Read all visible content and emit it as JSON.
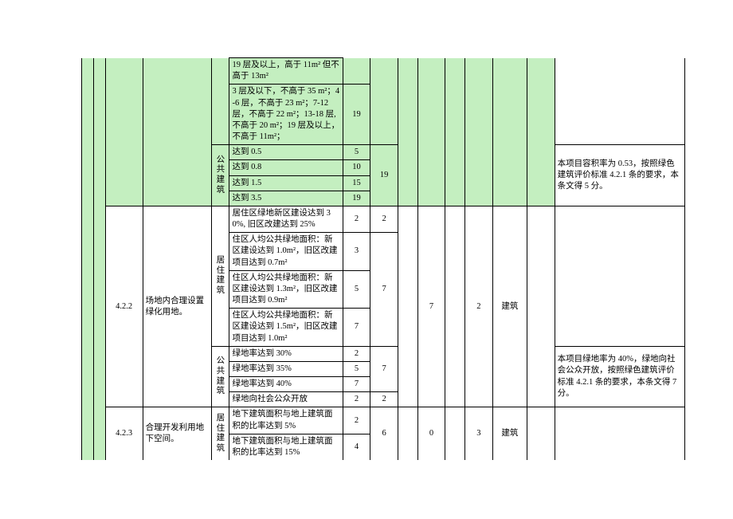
{
  "row421": {
    "type_label": "公共建筑",
    "r1_text": "19 层及以上，高于 11m² 但不高于 13m²",
    "r2_text": "3 层及以下，不高于 35 m²；4-6 层，不高于 23 m²；7-12 层，不高于 22 m²；13-18 层, 不高于 20 m²；19 层及以上，不高于 11m²；",
    "r2_score": "19",
    "level05": "达到 0.5",
    "score05": "5",
    "level08": "达到 0.8",
    "score08": "10",
    "level15": "达到 1.5",
    "score15": "15",
    "level35": "达到 3.5",
    "score35": "19",
    "subtotal": "19",
    "note": "本项目容积率为 0.53，按照绿色建筑评价标准 4.2.1 条的要求，本条文得 5 分。"
  },
  "row422": {
    "id": "4.2.2",
    "title": "场地内合理设置绿化用地。",
    "type1": "居住建筑",
    "type2": "公共建筑",
    "r1_text": "居住区绿地新区建设达到 30%, 旧区改建达到 25%",
    "r1_score": "2",
    "r1_sub": "2",
    "r2_text": "住区人均公共绿地面积：新区建设达到 1.0m²，旧区改建项目达到 0.7m²",
    "r2_score": "3",
    "r3_text": "住区人均公共绿地面积：新区建设达到 1.3m²，旧区改建项目达到 0.9m²",
    "r3_score": "5",
    "r4_text": "住区人均公共绿地面积：新区建设达到 1.5m²，旧区改建项目达到 1.0m²",
    "r4_score": "7",
    "r234_sub": "7",
    "g30": "绿地率达到 30%",
    "g30s": "2",
    "g35": "绿地率达到 35%",
    "g35s": "5",
    "g40": "绿地率达到 40%",
    "g40s": "7",
    "gopen": "绿地向社会公众开放",
    "gopens": "2",
    "g_sub1": "7",
    "g_sub2": "2",
    "col_m1": "7",
    "col_m2": "2",
    "col_m3": "建筑",
    "note": "本项目绿地率为 40%，绿地向社会公众开放，按照绿色建筑评价标准 4.2.1 条的要求，本条文得 7 分。"
  },
  "row423": {
    "id": "4.2.3",
    "title": "合理开发利用地下空间。",
    "type1": "居住建筑",
    "r1_text": "地下建筑面积与地上建筑面积的比率达到 5%",
    "r1_score": "2",
    "r2_text": "地下建筑面积与地上建筑面积的比率达到 15%",
    "r2_score": "4",
    "sub": "6",
    "col_m1": "0",
    "col_m2": "3",
    "col_m3": "建筑"
  }
}
